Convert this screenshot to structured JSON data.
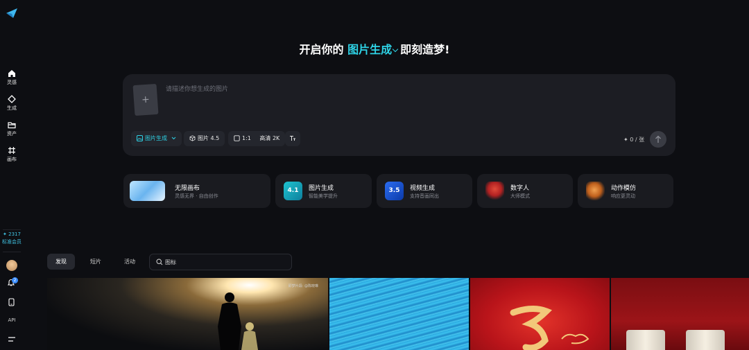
{
  "sidebar": {
    "items": [
      {
        "label": "灵感",
        "icon": "home-icon"
      },
      {
        "label": "生成",
        "icon": "diamond-icon"
      },
      {
        "label": "资产",
        "icon": "folder-icon"
      },
      {
        "label": "画布",
        "icon": "canvas-icon"
      }
    ],
    "points": "✦ 2317",
    "tier": "标准会员",
    "notification_count": "2",
    "api_label": "API"
  },
  "hero": {
    "prefix": "开启你的",
    "mode": "图片生成",
    "suffix": "即刻造梦!"
  },
  "prompt": {
    "upload_symbol": "+",
    "placeholder": "请描述你想生成的图片",
    "mode_button": "图片生成",
    "model_button": "图片 4.5",
    "ratio_label": "1:1",
    "quality_label": "高清 2K",
    "counter": "✦ 0 / 张"
  },
  "features": [
    {
      "title": "无限画布",
      "subtitle": "灵感无界 · 自由创作"
    },
    {
      "title": "图片生成",
      "subtitle": "智能美学提升",
      "badge": "4.1"
    },
    {
      "title": "视频生成",
      "subtitle": "支持音画同出",
      "badge": "3.5"
    },
    {
      "title": "数字人",
      "subtitle": "大师模式"
    },
    {
      "title": "动作模仿",
      "subtitle": "响应更灵动"
    }
  ],
  "tabs": [
    {
      "label": "发现"
    },
    {
      "label": "短片"
    },
    {
      "label": "活动"
    }
  ],
  "search": {
    "placeholder": "图标"
  },
  "gallery": {
    "caption": "即梦片段: @陈晓琳"
  },
  "colors": {
    "accent": "#2ed3e6",
    "background": "#0d0e12",
    "card": "#1c1d23"
  }
}
